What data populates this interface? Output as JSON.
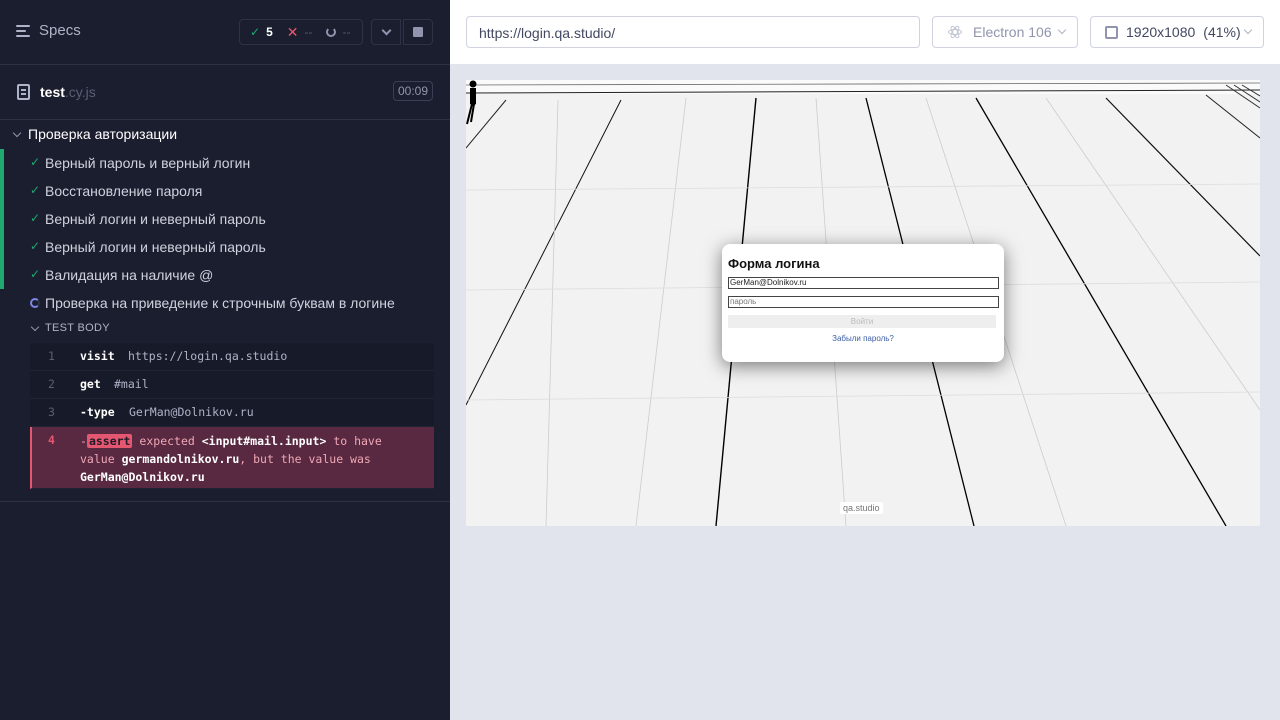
{
  "reporter": {
    "specs_label": "Specs",
    "stats": {
      "passed": "5",
      "failed": "--",
      "pending": "--"
    },
    "file": {
      "name": "test",
      "ext": ".cy.js",
      "duration": "00:09"
    },
    "suite_title": "Проверка авторизации",
    "tests": [
      {
        "title": "Верный пароль и верный логин",
        "state": "passed"
      },
      {
        "title": "Восстановление пароля",
        "state": "passed"
      },
      {
        "title": "Верный логин и неверный пароль",
        "state": "passed"
      },
      {
        "title": "Верный логин и неверный пароль",
        "state": "passed"
      },
      {
        "title": "Валидация на наличие @",
        "state": "passed"
      },
      {
        "title": "Проверка на приведение к строчным буквам в логине",
        "state": "running"
      }
    ],
    "test_body_label": "TEST BODY",
    "commands": [
      {
        "num": "1",
        "name": "visit",
        "arg": "https://login.qa.studio"
      },
      {
        "num": "2",
        "name": "get",
        "arg": "#mail"
      },
      {
        "num": "3",
        "name": "-type",
        "arg": "GerMan@Dolnikov.ru"
      }
    ],
    "error": {
      "num": "4",
      "dash": "-",
      "tag": "assert",
      "expected": "expected",
      "selector": "<input#mail.input>",
      "to_have": "to have",
      "value_word": "value",
      "expected_value": "germandolnikov.ru",
      "but_was": ", but the value was",
      "actual_value": "GerMan@Dolnikov.ru"
    }
  },
  "aut": {
    "url": "https://login.qa.studio/",
    "browser": "Electron 106",
    "viewport": "1920x1080",
    "scale": "(41%)",
    "form": {
      "title": "Форма логина",
      "email_value": "GerMan@Dolnikov.ru",
      "password_placeholder": "пароль",
      "submit_label": "Войти",
      "forgot_link": "Забыли пароль?"
    },
    "badge": "qa.studio"
  }
}
